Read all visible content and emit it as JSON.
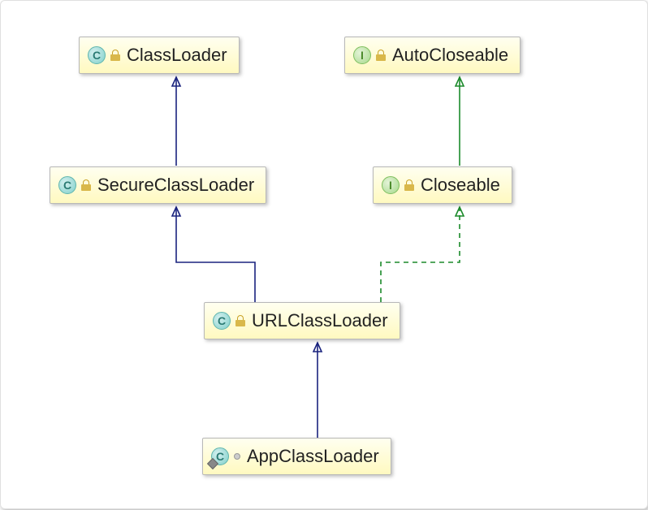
{
  "diagram": {
    "nodes": {
      "classLoader": {
        "kind": "C",
        "vis": "lock",
        "label": "ClassLoader"
      },
      "autoCloseable": {
        "kind": "I",
        "vis": "lock",
        "label": "AutoCloseable"
      },
      "secureClassLoader": {
        "kind": "C",
        "vis": "lock",
        "label": "SecureClassLoader"
      },
      "closeable": {
        "kind": "I",
        "vis": "lock",
        "label": "Closeable"
      },
      "urlClassLoader": {
        "kind": "C",
        "vis": "lock",
        "label": "URLClassLoader"
      },
      "appClassLoader": {
        "kind": "C",
        "vis": "dot",
        "label": "AppClassLoader",
        "pinned": true
      }
    },
    "edges": [
      {
        "from": "secureClassLoader",
        "to": "classLoader",
        "type": "extends"
      },
      {
        "from": "urlClassLoader",
        "to": "secureClassLoader",
        "type": "extends"
      },
      {
        "from": "appClassLoader",
        "to": "urlClassLoader",
        "type": "extends"
      },
      {
        "from": "closeable",
        "to": "autoCloseable",
        "type": "extends-interface"
      },
      {
        "from": "urlClassLoader",
        "to": "closeable",
        "type": "implements"
      }
    ],
    "edgeStyles": {
      "extends": {
        "stroke": "#1a237e",
        "dash": "none"
      },
      "extends-interface": {
        "stroke": "#1b8a2a",
        "dash": "none"
      },
      "implements": {
        "stroke": "#1b8a2a",
        "dash": "6,5"
      }
    }
  }
}
